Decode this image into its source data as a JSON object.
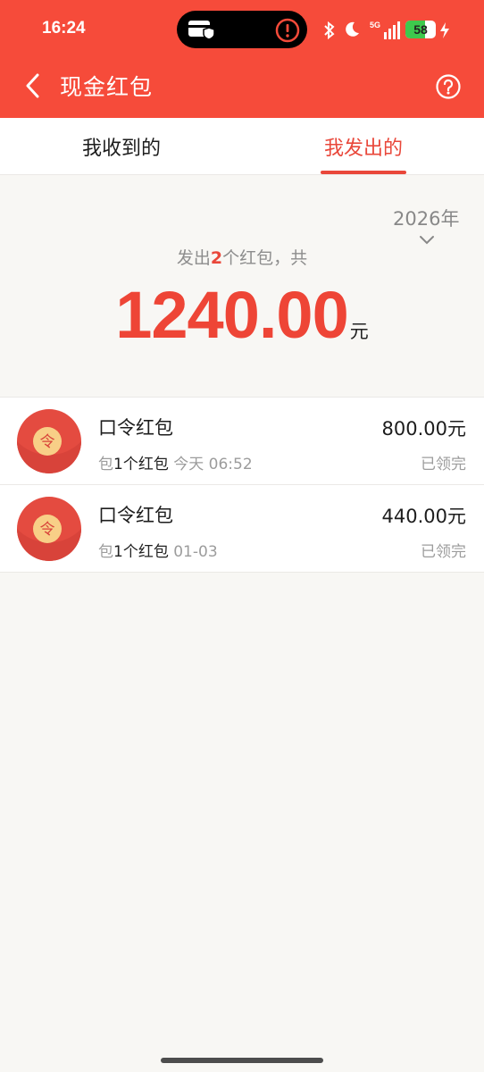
{
  "status_bar": {
    "time": "16:24",
    "battery": "58",
    "network": "5G",
    "icons": [
      "wallet-card-icon",
      "alert-icon",
      "bluetooth-icon",
      "moon-icon",
      "signal-icon",
      "charging-icon"
    ]
  },
  "nav": {
    "title": "现金红包",
    "back_icon": "chevron-left-icon",
    "help_icon": "question-circle-icon"
  },
  "tabs": [
    {
      "label": "我收到的",
      "active": false
    },
    {
      "label": "我发出的",
      "active": true
    }
  ],
  "summary": {
    "year": "2026年",
    "prefix": "发出",
    "count": "2",
    "suffix": "个红包，共",
    "total": "1240.00",
    "unit": "元"
  },
  "records": [
    {
      "title": "口令红包",
      "qty_prefix": "包",
      "qty": "1个红包",
      "time": "今天 06:52",
      "amount": "800.00元",
      "status": "已领完",
      "badge": "令"
    },
    {
      "title": "口令红包",
      "qty_prefix": "包",
      "qty": "1个红包",
      "time": "01-03",
      "amount": "440.00元",
      "status": "已领完",
      "badge": "令"
    }
  ],
  "colors": {
    "brand_red": "#f64b3a",
    "accent_red": "#e9473a",
    "page_bg": "#f8f7f4"
  }
}
